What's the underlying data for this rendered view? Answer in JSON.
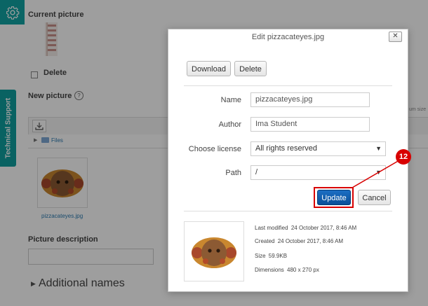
{
  "background": {
    "current_picture_label": "Current picture",
    "delete_label": "Delete",
    "new_picture_label": "New picture",
    "help_glyph": "?",
    "files_folder_label": "Files",
    "thumb_filename": "pizzacateyes.jpg",
    "picture_description_label": "Picture description",
    "additional_names_label": "Additional names",
    "max_size_fragment": "um size",
    "tech_support_label": "Technical Support"
  },
  "dialog": {
    "title": "Edit pizzacateyes.jpg",
    "close_glyph": "✕",
    "download_label": "Download",
    "delete_label": "Delete",
    "fields": {
      "name_label": "Name",
      "name_value": "pizzacateyes.jpg",
      "author_label": "Author",
      "author_value": "Ima Student",
      "license_label": "Choose license",
      "license_value": "All rights reserved",
      "path_label": "Path",
      "path_value": "/"
    },
    "update_label": "Update",
    "cancel_label": "Cancel",
    "info": {
      "last_modified_label": "Last modified",
      "last_modified_value": "24 October 2017, 8:46 AM",
      "created_label": "Created",
      "created_value": "24 October 2017, 8:46 AM",
      "size_label": "Size",
      "size_value": "59.9KB",
      "dimensions_label": "Dimensions",
      "dimensions_value": "480 x 270 px"
    }
  },
  "callout": {
    "number": "12"
  },
  "colors": {
    "accent": "#11a3a3",
    "update_button": "#0b57a8",
    "callout": "#d80000"
  },
  "icons": [
    "gear-icon",
    "help-icon",
    "download-icon",
    "folder-icon",
    "caret-right-icon",
    "close-icon",
    "dropdown-arrow-icon"
  ]
}
